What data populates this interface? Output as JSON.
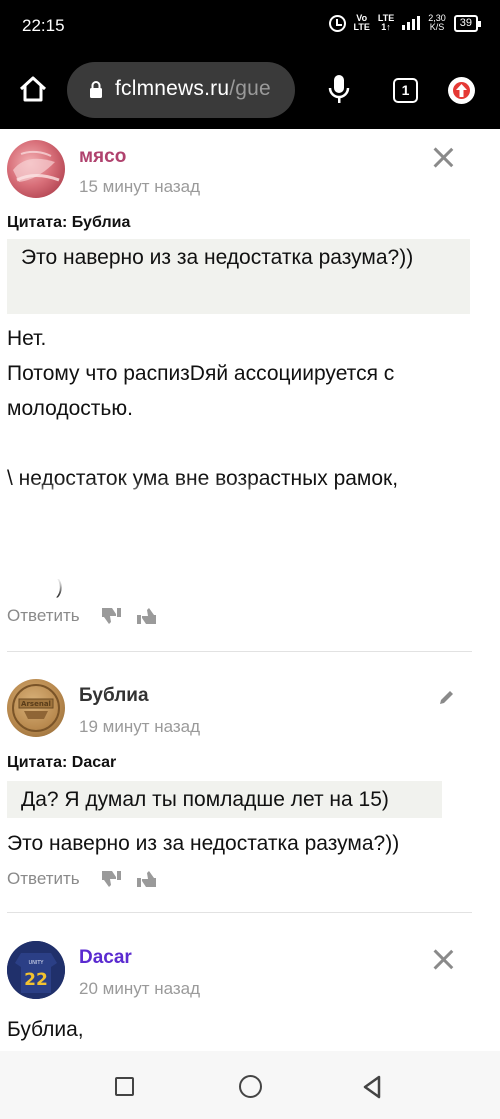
{
  "status_bar": {
    "time": "22:15",
    "network_top": "Vo",
    "network_bottom": "LTE",
    "network2_top": "LTE",
    "network2_bottom": "1↑",
    "speed_top": "2,30",
    "speed_bottom": "K/S",
    "battery": "39"
  },
  "browser": {
    "url_main": "fclmnews.ru",
    "url_faded": "/gue",
    "tab_count": "1",
    "icons": [
      "home-icon",
      "lock-icon",
      "mic-icon",
      "tabs-icon",
      "update-icon"
    ]
  },
  "comments": [
    {
      "author": "мясо",
      "author_color": "#b0426e",
      "time": "15 минут назад",
      "quote_label": "Цитата: Бублиа",
      "quote": "Это наверно из за недостатка разума?))",
      "body": "Нет.\nПотому что распизDяй ассоциируется с молодостью.\n\n\\ недостаток ума вне возрастных рамок,",
      "body_tail": ")",
      "reply": "Ответить"
    },
    {
      "author": "Бублиа",
      "author_color": "#333333",
      "time": "19 минут назад",
      "quote_label": "Цитата: Dacar",
      "quote": "Да? Я думал ты помладше лет на 15)",
      "body": "Это наверно из за недостатка разума?))",
      "reply": "Ответить"
    },
    {
      "author": "Dacar",
      "author_color": "#5b2bd0",
      "time": "20 минут назад",
      "body": "Бублиа,"
    }
  ],
  "avatar_text": {
    "arsenal": "Arsenal",
    "jersey_number": "22",
    "jersey_top": "UNITY"
  }
}
